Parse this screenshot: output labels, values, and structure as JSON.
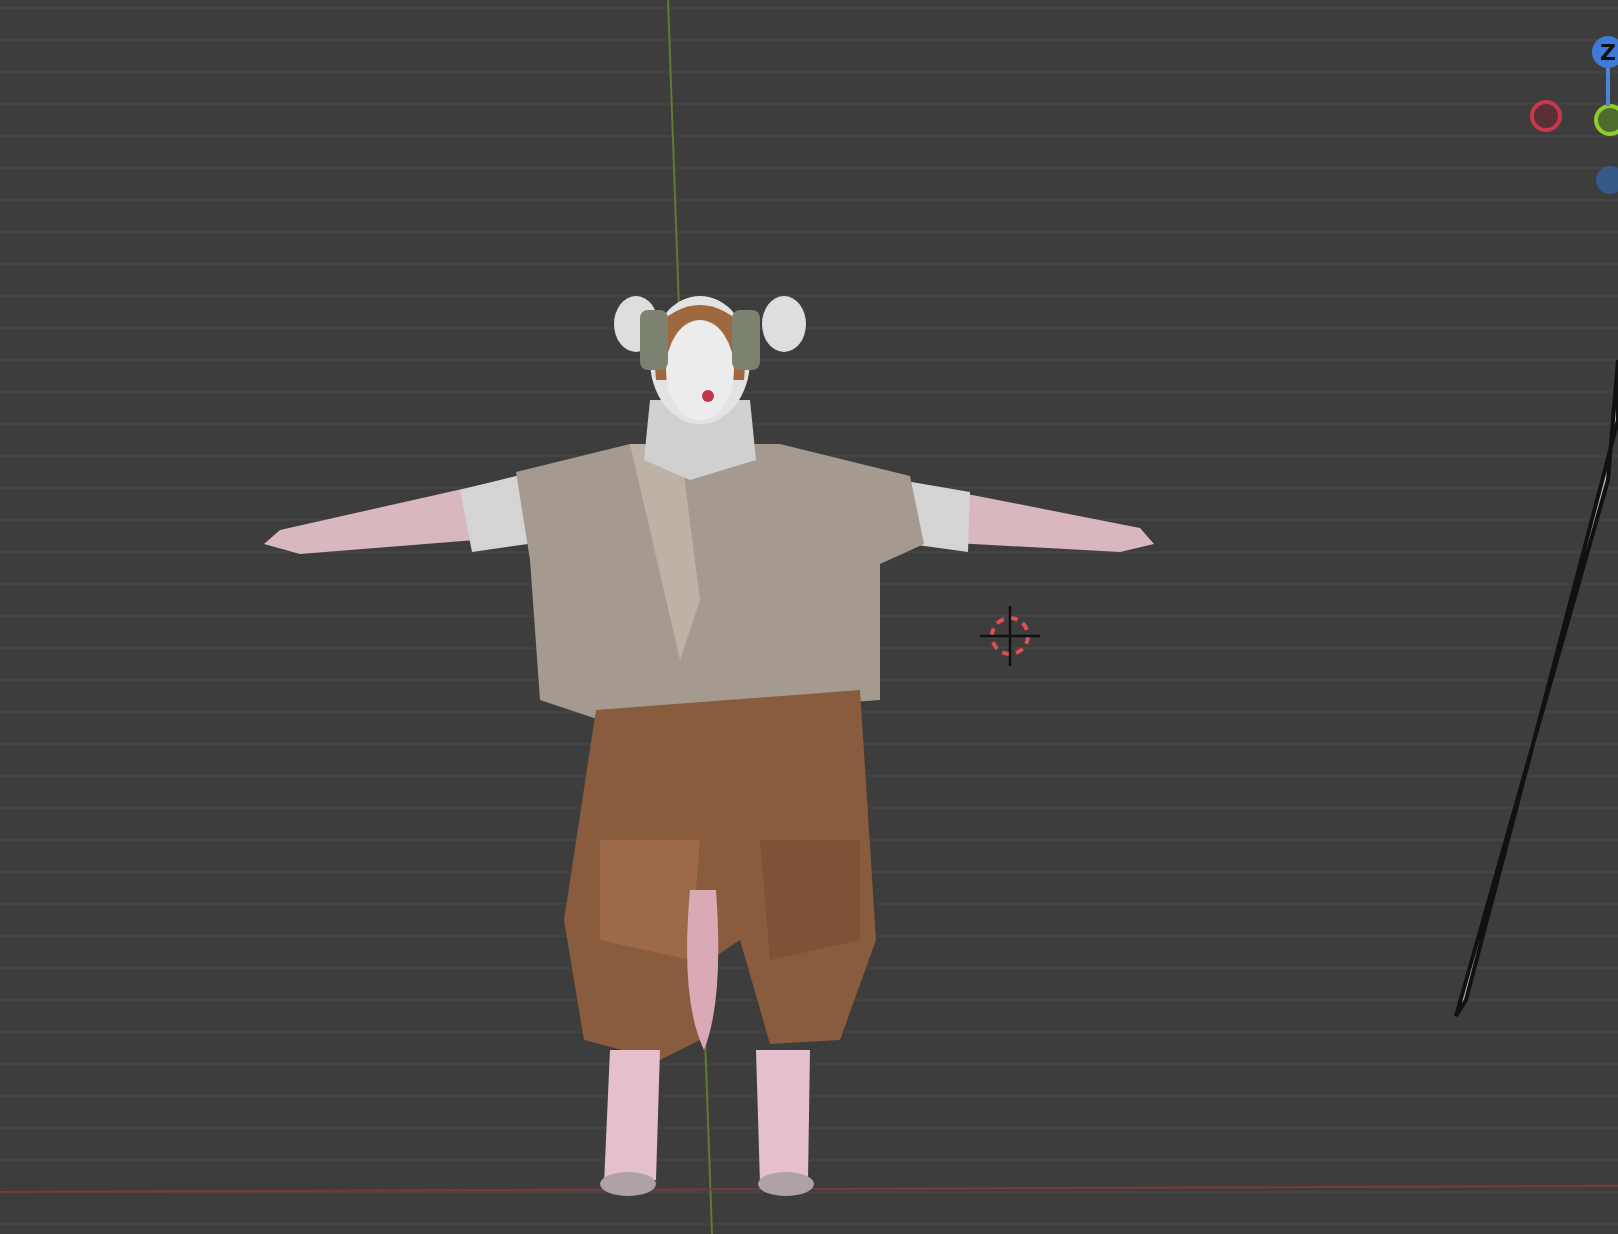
{
  "viewport": {
    "gizmo": {
      "z_label": "Z"
    }
  }
}
